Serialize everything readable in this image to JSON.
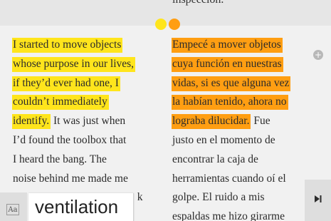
{
  "colors": {
    "highlight_yellow": "#ffe51c",
    "highlight_orange": "#ff9e12",
    "plus_grey": "#b8b8b8"
  },
  "top": {
    "text": "inspección."
  },
  "left_column": {
    "lines": [
      {
        "hl": "I started to move objects",
        "rest": ""
      },
      {
        "hl": "whose purpose in our lives,",
        "rest": ""
      },
      {
        "hl": "if they’d ever had one, I",
        "rest": ""
      },
      {
        "hl": "couldn’t immediately",
        "rest": ""
      },
      {
        "hl": "identify.",
        "rest": " It was just when"
      },
      {
        "hl": "",
        "rest": "I’d found the toolbox that"
      },
      {
        "hl": "",
        "rest": "I heard the bang. The"
      },
      {
        "hl": "",
        "rest": "noise behind me made me"
      },
      {
        "hl": "",
        "rest": "j                                            k"
      }
    ]
  },
  "right_column": {
    "lines": [
      {
        "hl": "Empecé a mover objetos",
        "rest": ""
      },
      {
        "hl": "cuya función en nuestras",
        "rest": ""
      },
      {
        "hl": "vidas, si es que alguna vez",
        "rest": ""
      },
      {
        "hl": "la habían tenido, ahora no",
        "rest": ""
      },
      {
        "hl": "lograba dilucidar.",
        "rest": " Fue"
      },
      {
        "hl": "",
        "rest": "justo en el momento de"
      },
      {
        "hl": "",
        "rest": "encontrar la caja de"
      },
      {
        "hl": "",
        "rest": "herramientas cuando oí el"
      },
      {
        "hl": "",
        "rest": "golpe. El ruido a mis"
      },
      {
        "hl": "",
        "rest": "espaldas me hizo girarme"
      }
    ]
  },
  "controls": {
    "font_button": "Aa",
    "lookup_word": "ventilation",
    "plus_icon": "plus-icon",
    "end_icon": "skip-to-end-icon"
  }
}
